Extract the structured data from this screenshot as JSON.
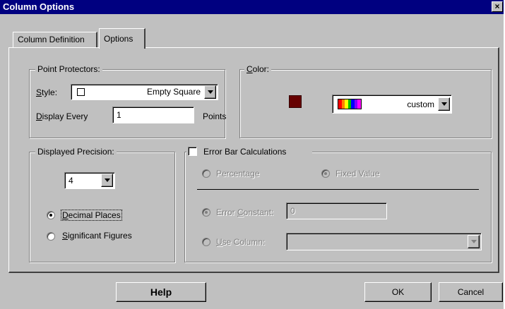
{
  "window": {
    "title": "Column Options",
    "close_glyph": "×"
  },
  "tabs": [
    {
      "label": "Column Definition",
      "active": false
    },
    {
      "label": "Options",
      "active": true
    }
  ],
  "point_protectors": {
    "group_title": "Point Protectors:",
    "style_label": "Style:",
    "style_value": "Empty Square",
    "display_every_label": "Display Every",
    "display_every_value": "1",
    "points_label": "Points"
  },
  "color": {
    "group_title": "Color:",
    "swatch_color": "#660000",
    "palette_value": "custom",
    "palette_colors": [
      "#ff0000",
      "#ff8000",
      "#ffff00",
      "#00c000",
      "#0000ff",
      "#8000ff",
      "#ff00ff"
    ]
  },
  "precision": {
    "group_title": "Displayed Precision:",
    "value": "4",
    "option_decimal": "Decimal Places",
    "option_significant": "Significant Figures",
    "selected": "decimal"
  },
  "error_bar": {
    "group_title": "Error Bar Calculations",
    "checked": false,
    "option_percentage": "Percentage",
    "option_fixed": "Fixed Value",
    "selected_type": "fixed",
    "error_constant_label": "Error Constant:",
    "error_constant_value": "0",
    "use_column_label": "Use Column:",
    "use_column_value": "",
    "selected_source": "constant"
  },
  "buttons": {
    "help": "Help",
    "ok": "OK",
    "cancel": "Cancel"
  },
  "icons": {
    "style_swatch": "empty-square-icon",
    "dropdown": "chevron-down-icon",
    "palette": "rainbow-palette-icon"
  },
  "colors": {
    "title_bar": "#000080",
    "dialog_face": "#c0c0c0"
  }
}
